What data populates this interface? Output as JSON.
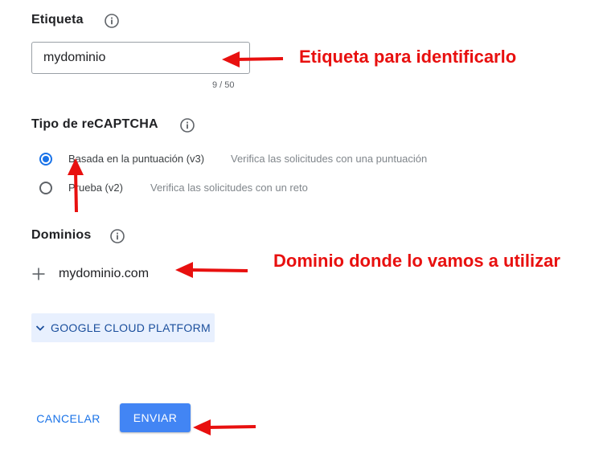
{
  "label_section": {
    "title": "Etiqueta",
    "input_value": "mydominio",
    "counter": "9 / 50"
  },
  "recaptcha_section": {
    "title": "Tipo de reCAPTCHA",
    "options": [
      {
        "label": "Basada en la puntuación (v3)",
        "description": "Verifica las solicitudes con una puntuación",
        "selected": true
      },
      {
        "label": "Prueba (v2)",
        "description": "Verifica las solicitudes con un reto",
        "selected": false
      }
    ]
  },
  "domains_section": {
    "title": "Dominios",
    "domain": "mydominio.com"
  },
  "gcp_toggle": {
    "label": "GOOGLE CLOUD PLATFORM"
  },
  "actions": {
    "cancel": "CANCELAR",
    "submit": "ENVIAR"
  },
  "annotations": {
    "label_note": "Etiqueta para identificarlo",
    "domain_note": "Dominio donde lo vamos a utilizar"
  },
  "colors": {
    "accent": "#1a73e8",
    "submit_bg": "#4285f4",
    "annotation": "#e8100f",
    "gcp_bg": "#e8f0fe"
  }
}
